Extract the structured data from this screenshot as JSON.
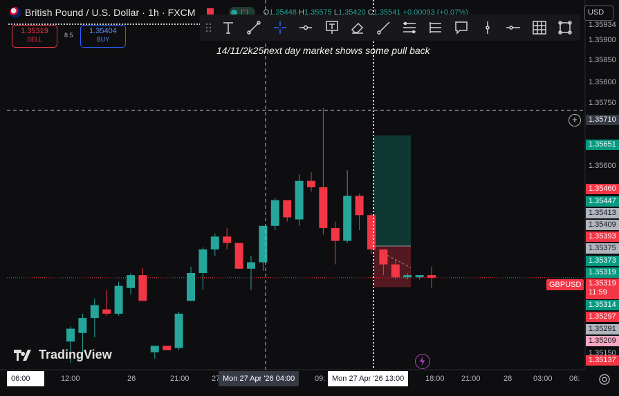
{
  "header": {
    "symbol_title": "British Pound / U.S. Dollar · 1h · FXCM",
    "ohlc": {
      "o_label": "O",
      "o": "1.35448",
      "h_label": "H",
      "h": "1.35575",
      "l_label": "L",
      "l": "1.35420",
      "c_label": "C",
      "c": "1.35541",
      "change": "+0.00093 (+0.07%)"
    }
  },
  "trade": {
    "sell_price": "1.35319",
    "sell_label": "SELL",
    "spread": "8.5",
    "buy_price": "1.35404",
    "buy_label": "BUY"
  },
  "annotation": "14/11/2k25next day market shows some pull back",
  "currency": "USD",
  "toolbar": {
    "tools": [
      "text-tool-icon",
      "trend-line-icon",
      "crosshair-icon",
      "horizontal-ray-icon",
      "text-box-icon",
      "eraser-icon",
      "ray-icon",
      "parallel-channel-icon",
      "fib-retracement-icon",
      "callout-icon",
      "vertical-line-icon",
      "horizontal-line-icon",
      "grid-icon",
      "rectangle-icon"
    ]
  },
  "price_axis": {
    "ticks": [
      "1.35934",
      "1.35900",
      "1.35850",
      "1.35800",
      "1.35750",
      "1.35600",
      "1.35150"
    ],
    "crosshair_price": "1.35710",
    "labels": [
      {
        "v": "1.35651",
        "c": "green"
      },
      {
        "v": "1.35460",
        "c": "red"
      },
      {
        "v": "1.35447",
        "c": "green"
      },
      {
        "v": "1.35413",
        "c": "gray"
      },
      {
        "v": "1.35409",
        "c": "gray"
      },
      {
        "v": "1.35393",
        "c": "red"
      },
      {
        "v": "1.35375",
        "c": "gray"
      },
      {
        "v": "1.35373",
        "c": "green"
      },
      {
        "v": "1.35319",
        "c": "green"
      },
      {
        "v": "1.35314",
        "c": "green"
      },
      {
        "v": "1.35297",
        "c": "red"
      },
      {
        "v": "1.35291",
        "c": "gray"
      },
      {
        "v": "1.35209",
        "c": "pink"
      },
      {
        "v": "1.35137",
        "c": "red"
      }
    ],
    "symbol_badge": "GBPUSD",
    "current_price": "1.35319",
    "countdown": "11:59"
  },
  "time_axis": {
    "labels": [
      "06:00",
      "12:00",
      "26",
      "21:00",
      "27",
      "09:",
      "18:00",
      "21:00",
      "28",
      "03:00",
      "06:"
    ],
    "crosshair_left": "Mon 27 Apr '26   04:00",
    "crosshair_right": "Mon 27 Apr '26   13:00"
  },
  "logo": "TradingView",
  "colors": {
    "up": "#26a69a",
    "down": "#f23645",
    "bg": "#0e0e10"
  },
  "chart_data": {
    "type": "candlestick",
    "ylim": [
      1.3512,
      1.3594
    ],
    "candles": [
      {
        "o": 1.3517,
        "h": 1.35205,
        "l": 1.3512,
        "c": 1.352
      },
      {
        "o": 1.3519,
        "h": 1.35235,
        "l": 1.3513,
        "c": 1.35225
      },
      {
        "o": 1.35225,
        "h": 1.3527,
        "l": 1.3518,
        "c": 1.35255
      },
      {
        "o": 1.35245,
        "h": 1.3529,
        "l": 1.3523,
        "c": 1.35235
      },
      {
        "o": 1.35235,
        "h": 1.3531,
        "l": 1.3523,
        "c": 1.353
      },
      {
        "o": 1.35295,
        "h": 1.3533,
        "l": 1.3528,
        "c": 1.35325
      },
      {
        "o": 1.35325,
        "h": 1.35342,
        "l": 1.35265,
        "c": 1.35265
      },
      {
        "o": 1.35145,
        "h": 1.35145,
        "l": 1.3513,
        "c": 1.3516
      },
      {
        "o": 1.3516,
        "h": 1.3516,
        "l": 1.3515,
        "c": 1.3515
      },
      {
        "o": 1.35155,
        "h": 1.3524,
        "l": 1.3515,
        "c": 1.35235
      },
      {
        "o": 1.35265,
        "h": 1.35345,
        "l": 1.35265,
        "c": 1.3533
      },
      {
        "o": 1.3533,
        "h": 1.3539,
        "l": 1.3529,
        "c": 1.35385
      },
      {
        "o": 1.35385,
        "h": 1.35422,
        "l": 1.3537,
        "c": 1.35415
      },
      {
        "o": 1.35415,
        "h": 1.35435,
        "l": 1.35385,
        "c": 1.354
      },
      {
        "o": 1.354,
        "h": 1.354,
        "l": 1.3534,
        "c": 1.3534
      },
      {
        "o": 1.3534,
        "h": 1.3537,
        "l": 1.3529,
        "c": 1.35355
      },
      {
        "o": 1.35355,
        "h": 1.3544,
        "l": 1.35335,
        "c": 1.3544
      },
      {
        "o": 1.3544,
        "h": 1.35505,
        "l": 1.3543,
        "c": 1.355
      },
      {
        "o": 1.355,
        "h": 1.355,
        "l": 1.3545,
        "c": 1.3546
      },
      {
        "o": 1.35455,
        "h": 1.3556,
        "l": 1.3544,
        "c": 1.35545
      },
      {
        "o": 1.35545,
        "h": 1.35565,
        "l": 1.3552,
        "c": 1.3553
      },
      {
        "o": 1.3553,
        "h": 1.35715,
        "l": 1.3542,
        "c": 1.35435
      },
      {
        "o": 1.35435,
        "h": 1.3545,
        "l": 1.3535,
        "c": 1.35405
      },
      {
        "o": 1.35405,
        "h": 1.3557,
        "l": 1.354,
        "c": 1.3551
      },
      {
        "o": 1.3551,
        "h": 1.35515,
        "l": 1.3543,
        "c": 1.35465
      },
      {
        "o": 1.35465,
        "h": 1.3547,
        "l": 1.35375,
        "c": 1.35385
      },
      {
        "o": 1.35385,
        "h": 1.35385,
        "l": 1.35325,
        "c": 1.3535
      },
      {
        "o": 1.3535,
        "h": 1.3536,
        "l": 1.35315,
        "c": 1.3532
      },
      {
        "o": 1.3532,
        "h": 1.3533,
        "l": 1.35315,
        "c": 1.35325
      },
      {
        "o": 1.3532,
        "h": 1.35325,
        "l": 1.35315,
        "c": 1.35325
      },
      {
        "o": 1.35325,
        "h": 1.35345,
        "l": 1.35295,
        "c": 1.35319
      }
    ],
    "current_price": 1.35319,
    "crosshair_price": 1.3571,
    "position": {
      "entry": 1.35393,
      "target": 1.35651,
      "stop": 1.35297
    }
  }
}
